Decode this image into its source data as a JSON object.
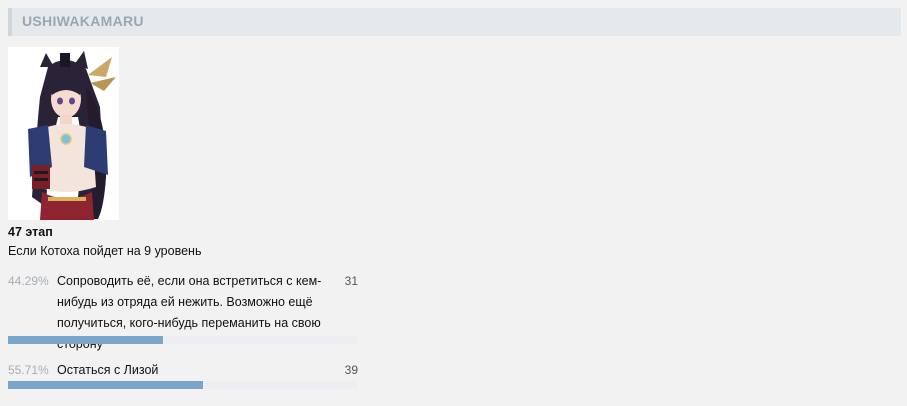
{
  "header": {
    "title": "USHIWAKAMARU"
  },
  "post": {
    "image_alt": "Ushiwakamaru character art",
    "stage": "47 этап",
    "question": "Если Котоха пойдет на 9 уровень"
  },
  "poll": {
    "options": [
      {
        "percent_label": "44.29%",
        "percent": 44.29,
        "text": "Сопроводить её, если она встретиться с кем-нибудь из отряда ей нежить. Возможно ещё получиться, кого-нибудь переманить на свою сторону",
        "votes": "31"
      },
      {
        "percent_label": "55.71%",
        "percent": 55.71,
        "text": "Остаться с Лизой",
        "votes": "39"
      }
    ]
  },
  "colors": {
    "header_bg": "#e6e9ec",
    "header_text": "#9aa6b2",
    "bar_fill": "#7aa6cc",
    "bar_track": "#eceef1"
  },
  "icons": [
    "character-portrait"
  ]
}
